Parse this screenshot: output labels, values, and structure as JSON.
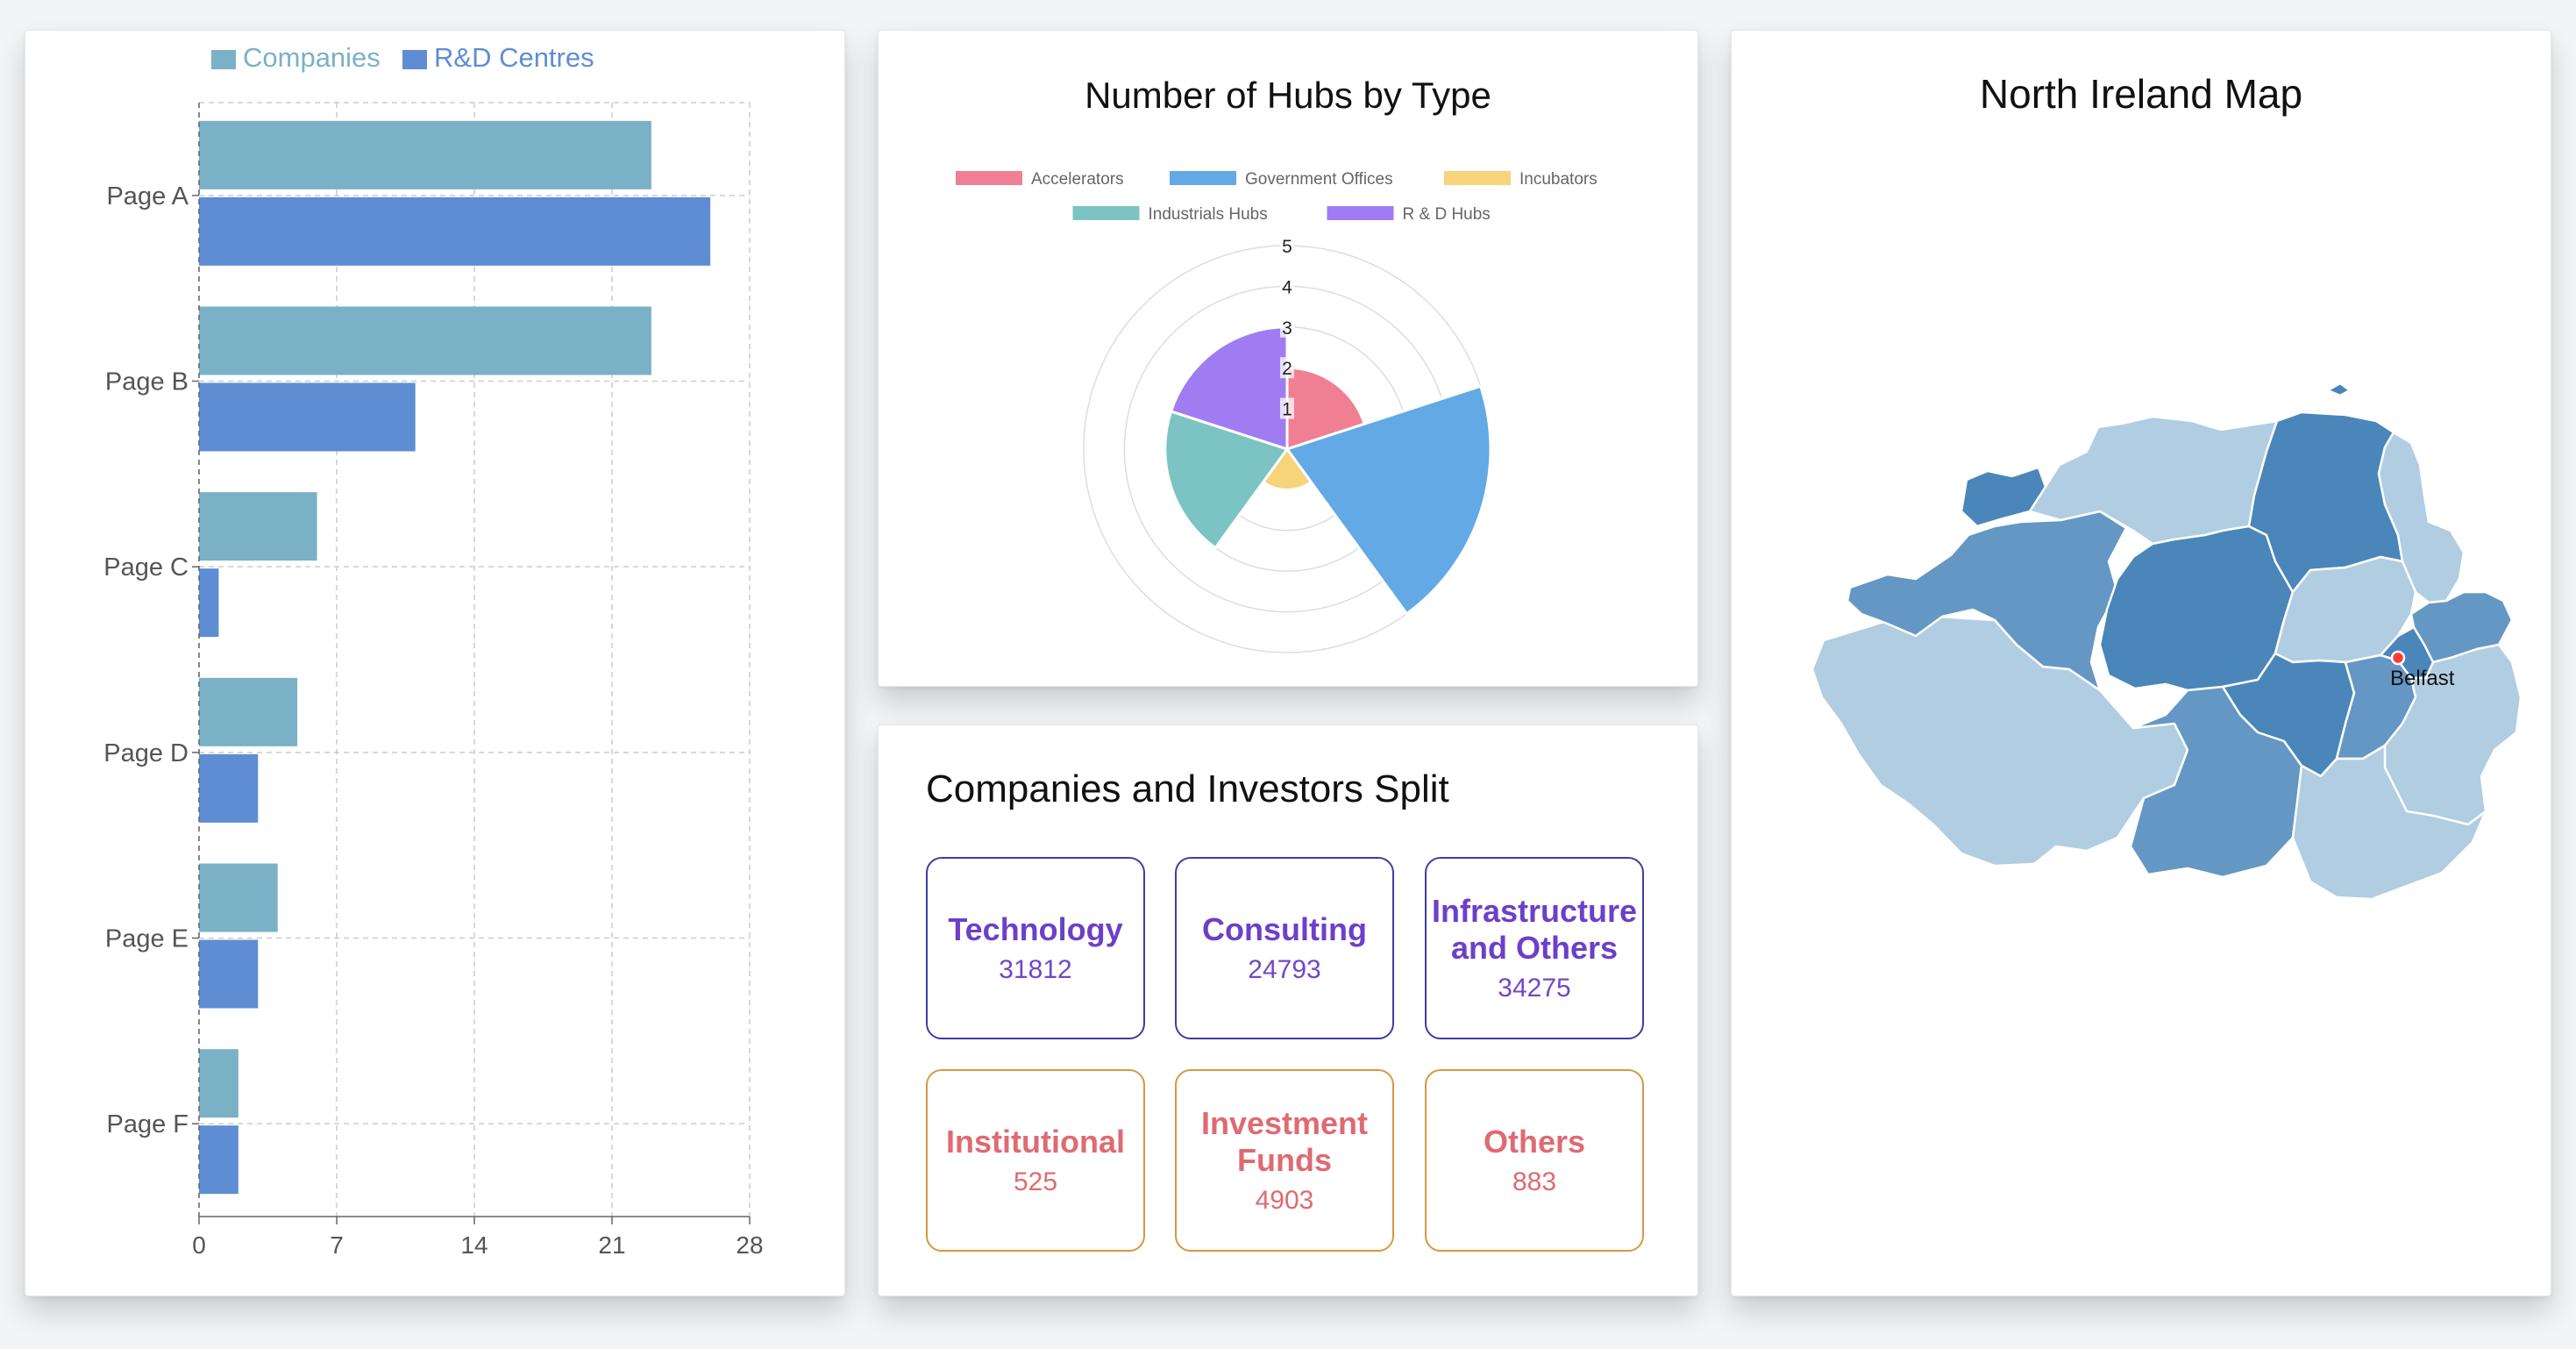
{
  "bar_chart": {
    "chart_data": {
      "type": "bar",
      "orientation": "horizontal",
      "categories": [
        "Page A",
        "Page B",
        "Page C",
        "Page D",
        "Page E",
        "Page F"
      ],
      "series": [
        {
          "name": "Companies",
          "values": [
            23,
            23,
            6,
            5,
            4,
            2
          ],
          "color": "#7ab1c7"
        },
        {
          "name": "R&D Centres",
          "values": [
            26,
            11,
            1,
            3,
            3,
            2
          ],
          "color": "#5f8dd3"
        }
      ],
      "xlim": [
        0,
        28
      ],
      "xticks": [
        0,
        7,
        14,
        21,
        28
      ],
      "grid": true,
      "legend": "top-left"
    }
  },
  "polar_chart": {
    "title": "Number of Hubs by Type",
    "chart_data": {
      "type": "polarArea",
      "categories": [
        "Accelerators",
        "Government Offices",
        "Incubators",
        "Industrials Hubs",
        "R & D Hubs"
      ],
      "values": [
        2,
        5,
        1,
        3,
        3
      ],
      "colors": [
        "#f07f93",
        "#62a9e6",
        "#f7d37a",
        "#7cc4c4",
        "#a07cf2"
      ],
      "rlim": [
        0,
        5
      ],
      "rticks": [
        1,
        2,
        3,
        4,
        5
      ],
      "legend": "top"
    }
  },
  "split": {
    "title": "Companies and Investors Split",
    "tiles": [
      {
        "name": "Technology",
        "value": "31812"
      },
      {
        "name": "Consulting",
        "value": "24793"
      },
      {
        "name": "Infrastructure and Others",
        "value": "34275"
      },
      {
        "name": "Institutional",
        "value": "525"
      },
      {
        "name": "Investment Funds",
        "value": "4903"
      },
      {
        "name": "Others",
        "value": "883"
      }
    ]
  },
  "map": {
    "title": "North Ireland Map",
    "marker_label": "Belfast",
    "colors": {
      "light": "#b0cde2",
      "mid": "#6597c4",
      "dark": "#4a86ba"
    }
  }
}
